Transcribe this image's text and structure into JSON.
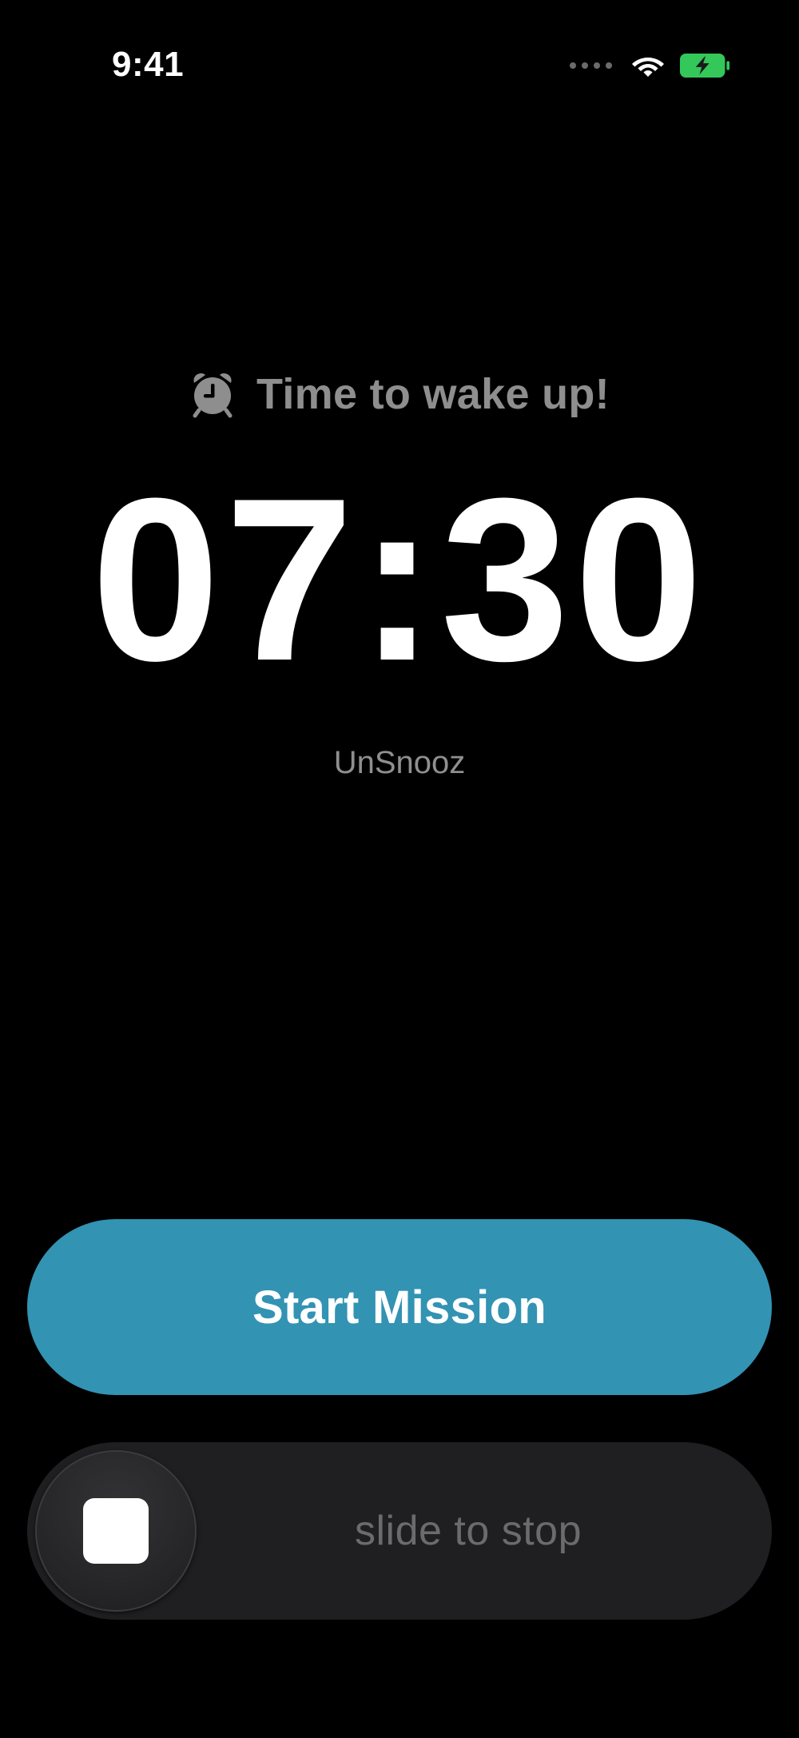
{
  "status_bar": {
    "time": "9:41",
    "battery_charging": true,
    "battery_color": "#34c759"
  },
  "alarm": {
    "icon": "alarm-clock-icon",
    "title": "Time to wake up!",
    "time": "07:30",
    "label": "UnSnooz"
  },
  "actions": {
    "start_mission_label": "Start Mission",
    "start_mission_color": "#3293b3",
    "slide_to_stop_label": "slide to stop",
    "slider_icon": "stop-square-icon"
  }
}
